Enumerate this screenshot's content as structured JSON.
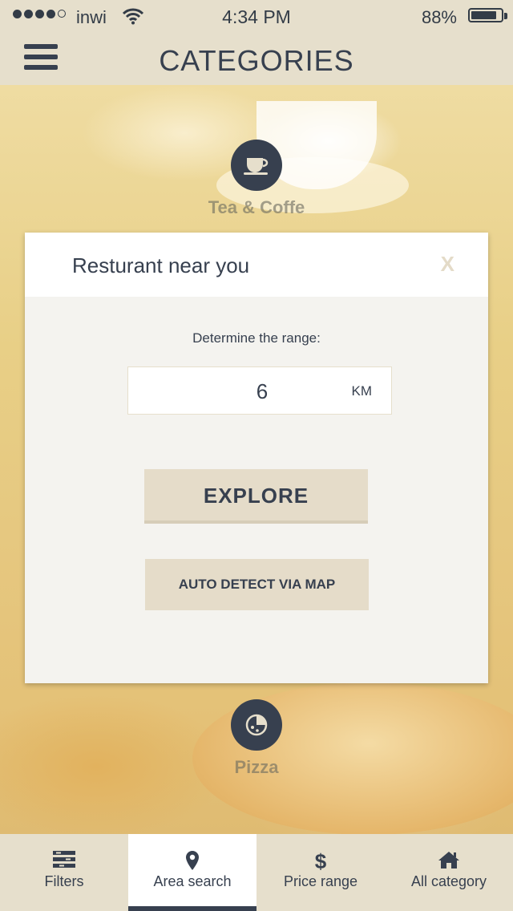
{
  "status_bar": {
    "carrier": "inwi",
    "time": "4:34 PM",
    "battery": "88%",
    "battery_level": 0.88,
    "signal_bars": 4,
    "signal_max": 5
  },
  "nav": {
    "title": "CATEGORIES",
    "menu_icon": "hamburger-menu-icon"
  },
  "categories": [
    {
      "label": "Tea & Coffe",
      "icon": "coffee-cup-icon"
    },
    {
      "label": "Pizza",
      "icon": "pizza-icon"
    }
  ],
  "modal": {
    "title": "Resturant near you",
    "close_label": "X",
    "range_label": "Determine the range:",
    "range_value": "6",
    "range_unit": "KM",
    "explore_label": "EXPLORE",
    "auto_detect_label": "AUTO DETECT VIA MAP"
  },
  "tabs": [
    {
      "label": "Filters",
      "icon": "filters-icon",
      "active": false
    },
    {
      "label": "Area search",
      "icon": "map-pin-icon",
      "active": true
    },
    {
      "label": "Price range",
      "icon": "dollar-icon",
      "active": false
    },
    {
      "label": "All category",
      "icon": "home-icon",
      "active": false
    }
  ],
  "colors": {
    "primary": "#37404f",
    "bar_beige": "#e6dfcc",
    "modal_bg": "#f4f3ef",
    "button_beige": "#e5dcc9"
  }
}
